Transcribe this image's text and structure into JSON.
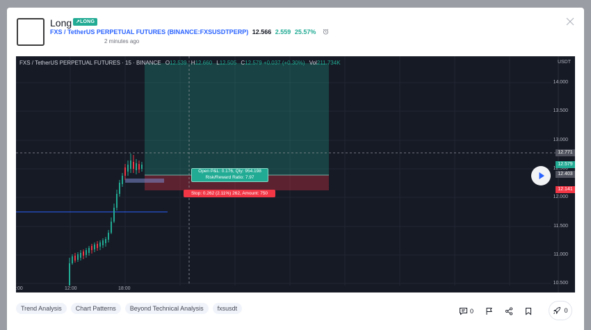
{
  "idea": {
    "title": "Long",
    "badge": "↗LONG",
    "symbol": "FXS / TetherUS PERPETUAL FUTURES (BINANCE:FXSUSDTPERP)",
    "price": "12.566",
    "change": "2.559",
    "change_pct": "25.57%",
    "time": "2 minutes ago"
  },
  "chart": {
    "legend_title": "FXS / TetherUS PERPETUAL FUTURES · 15 · BINANCE",
    "o_label": "O",
    "o": "12.539",
    "h_label": "H",
    "h": "12.660",
    "l_label": "L",
    "l": "12.505",
    "c_label": "C",
    "c": "12.579",
    "chg": "+0.037 (+0.30%)",
    "vol_label": "Vol",
    "vol": "211.734K",
    "currency": "USDT",
    "y_ticks": [
      "14.000",
      "13.500",
      "13.000",
      "12.500",
      "12.000",
      "11.500",
      "11.000",
      "10.500"
    ],
    "price_tags": {
      "crosshair": "12.771",
      "last": "12.579",
      "entry": "12.403",
      "stop": "12.141"
    },
    "x_ticks": [
      ":00",
      "12:00",
      "18:00"
    ],
    "pnl_line1": "Open P&L: 0.176, Qty: 954.198",
    "pnl_line2": "Risk/Reward Ratio: 7.97",
    "stop_label": "Stop: 0.262 (2.11%) 262, Amount: 750",
    "colors": {
      "up": "#22ab94",
      "down": "#f23645",
      "bg": "#161a25",
      "accent": "#2962ff"
    }
  },
  "tags": [
    "Trend Analysis",
    "Chart Patterns",
    "Beyond Technical Analysis",
    "fxsusdt"
  ],
  "actions": {
    "comments": "0",
    "boosts": "0"
  }
}
